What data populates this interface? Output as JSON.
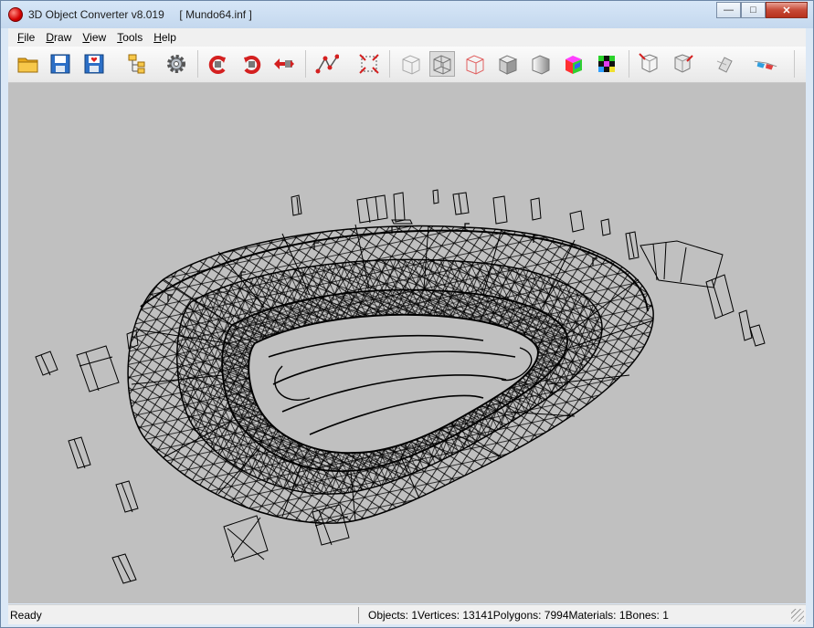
{
  "window": {
    "app_title": "3D Object Converter v8.019",
    "document": "[ Mundo64.inf ]",
    "controls": {
      "minimize": "—",
      "maximize": "□",
      "close": "✕"
    }
  },
  "menu": {
    "file": {
      "accel": "F",
      "rest": "ile"
    },
    "draw": {
      "accel": "D",
      "rest": "raw"
    },
    "view": {
      "accel": "V",
      "rest": "iew"
    },
    "tools": {
      "accel": "T",
      "rest": "ools"
    },
    "help": {
      "accel": "H",
      "rest": "elp"
    }
  },
  "toolbar": {
    "buttons": [
      "open-folder-icon",
      "save-icon",
      "save-as-icon",
      "hierarchy-icon",
      "settings-gear-icon",
      "rotate-ccw-icon",
      "rotate-cw-icon",
      "flip-icon",
      "vertex-edge-icon",
      "bounding-box-icon",
      "wireframe-hidden-icon",
      "wireframe-icon",
      "wireframe-red-icon",
      "flat-shaded-icon",
      "smooth-shaded-icon",
      "color-cube-icon",
      "textured-cube-icon",
      "camera-front-icon",
      "camera-side-icon",
      "snap-icon",
      "glasses-icon"
    ],
    "pressed": "wireframe-icon"
  },
  "status": {
    "ready": "Ready",
    "objects": "Objects: 1",
    "vertices": "Vertices: 13141",
    "polygons": "Polygons: 7994",
    "materials": "Materials: 1",
    "bones": "Bones: 1"
  },
  "colors": {
    "viewport_bg": "#c0c0c0",
    "wire": "#000000",
    "accent_red": "#e02020"
  }
}
